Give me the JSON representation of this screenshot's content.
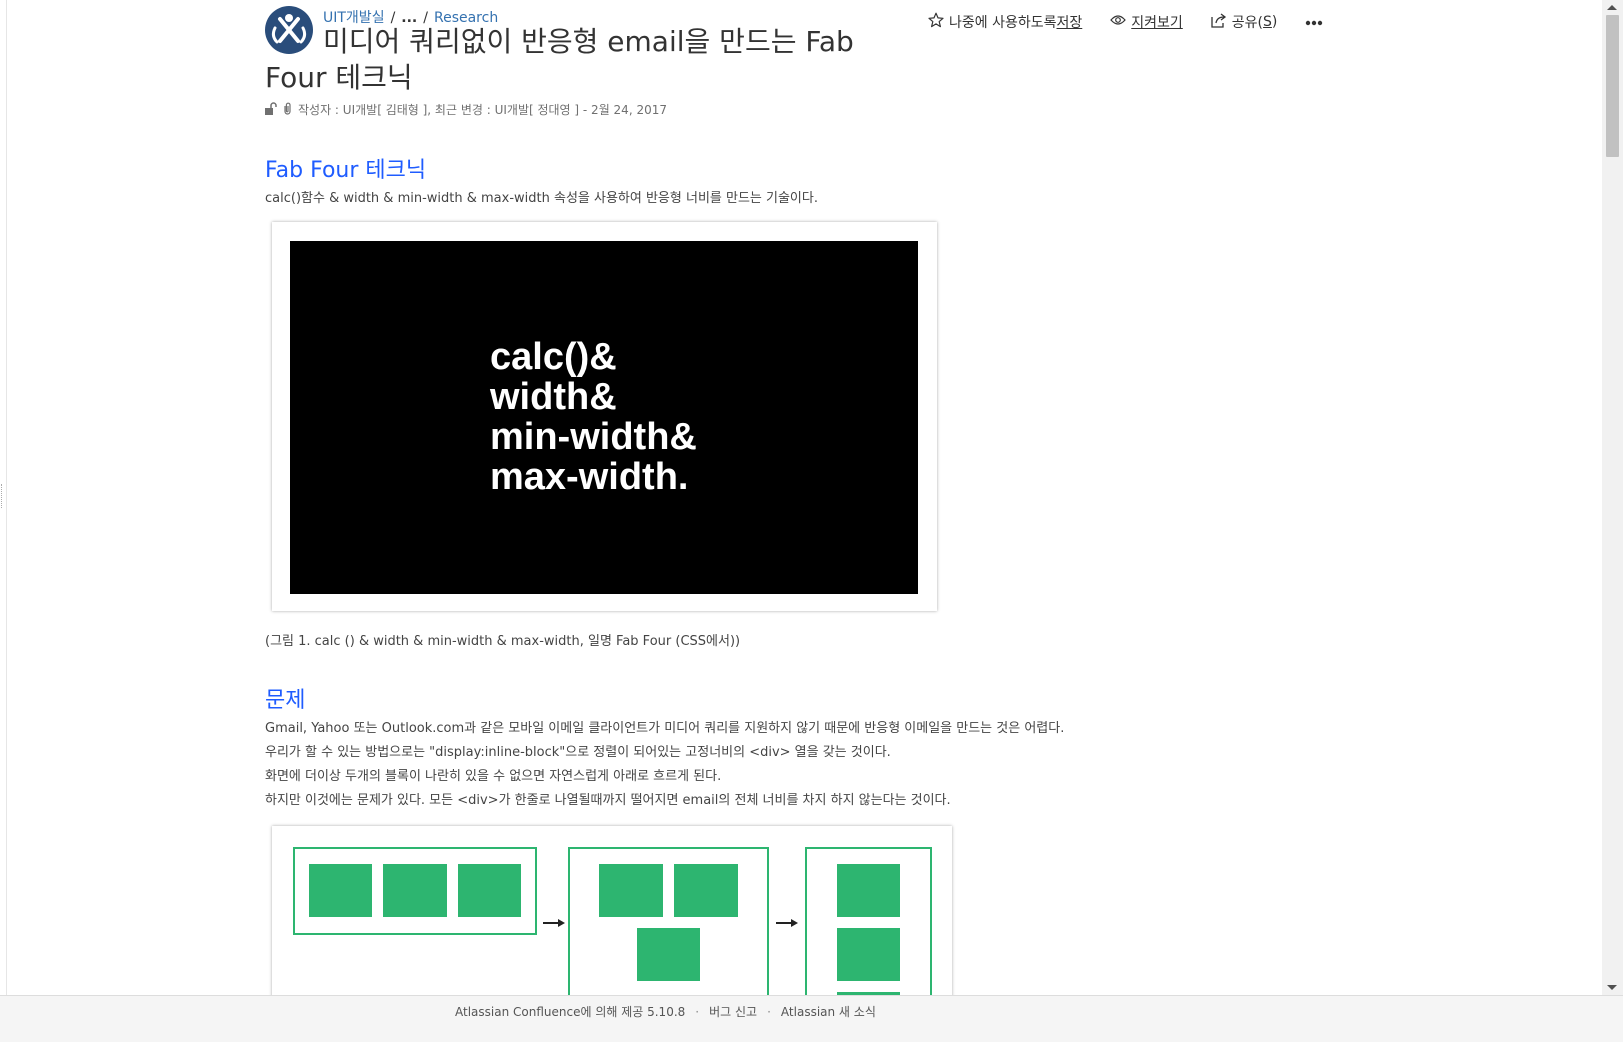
{
  "breadcrumb": {
    "space": "UIT개발실",
    "ellipsis": "...",
    "parent": "Research"
  },
  "page": {
    "title": "미디어 쿼리없이 반응형 email을 만드는 Fab Four 테크닉",
    "meta": "작성자 : UI개발[ 김태형 ], 최근 변경 : UI개발[ 정대영 ] - 2월 24, 2017"
  },
  "actions": {
    "save_prefix": "나중에 사용하도록 ",
    "save_key": "저장",
    "watch": "지켜보기",
    "share_prefix": "공유(",
    "share_key": "S",
    "share_suffix": ")",
    "more_icon": "ellipsis-icon"
  },
  "sections": {
    "fab_four": {
      "heading": "Fab Four 테크닉",
      "intro": "calc()함수 & width & min-width & max-width 속성을 사용하여 반응형 너비를 만드는 기술이다.",
      "figure_lines": [
        "calc()&",
        "width&",
        "min-width&",
        "max-width."
      ],
      "caption": "(그림 1. calc () & width & min-width & max-width, 일명 Fab Four (CSS에서))"
    },
    "problem": {
      "heading": "문제",
      "lines": [
        "Gmail, Yahoo 또는 Outlook.com과 같은 모바일 이메일 클라이언트가 미디어 쿼리를 지원하지 않기 때문에 반응형 이메일을 만드는 것은 어렵다.",
        "우리가 할 수 있는 방법으로는 \"display:inline-block\"으로 정렬이 되어있는 고정너비의 <div> 열을 갖는 것이다.",
        "화면에 더이상 두개의 블록이 나란히 있을 수 없으면 자연스럽게 아래로 흐르게 된다.",
        "하지만 이것에는 문제가 있다. 모든 <div>가 한줄로 나열될때까지 떨어지면 email의 전체 너비를 차지 하지 않는다는 것이다."
      ]
    }
  },
  "footer": {
    "powered": "Atlassian Confluence에 의해 제공 5.10.8",
    "bug": "버그 신고",
    "news": "Atlassian 새 소식"
  },
  "colors": {
    "link": "#3572b0",
    "heading": "#1f5cff",
    "logo_bg": "#2a4d7b",
    "diagram_green": "#2db570",
    "footer_bg": "#f5f5f5"
  }
}
